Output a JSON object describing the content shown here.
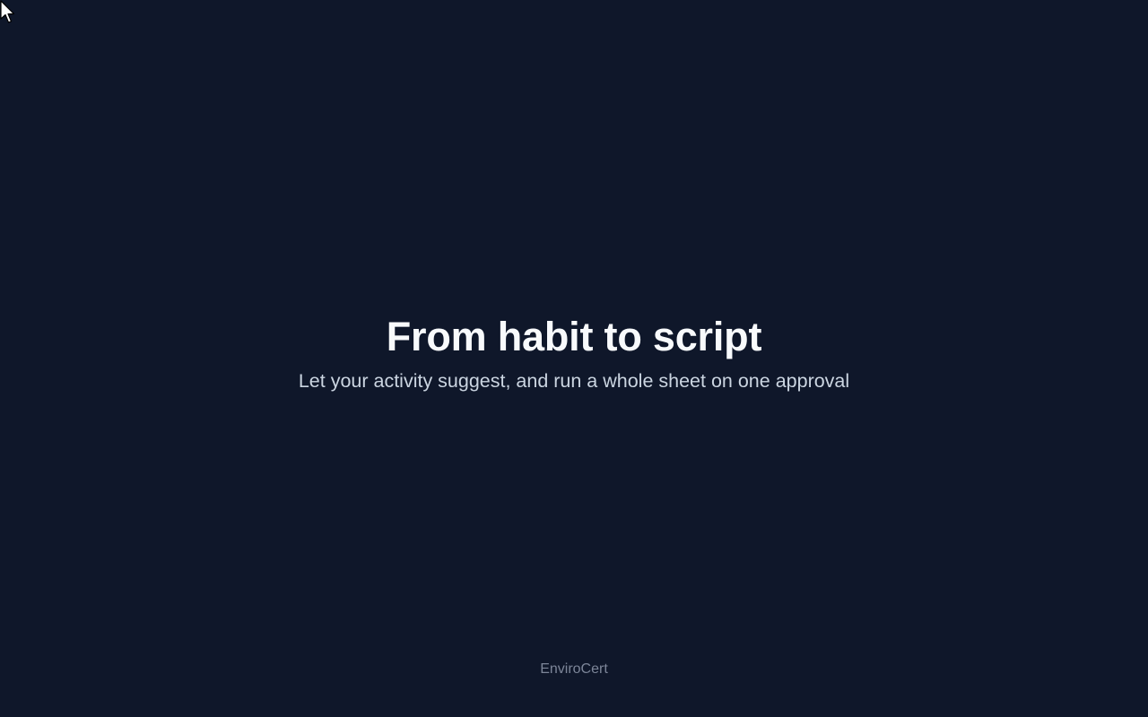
{
  "hero": {
    "title": "From habit to script",
    "subtitle": "Let your activity suggest, and run a whole sheet on one approval"
  },
  "footer": {
    "brand": "EnviroCert"
  },
  "colors": {
    "background": "#0f172a",
    "title": "#f8fafc",
    "subtitle": "#cbd5e1",
    "footer": "#7c8598"
  },
  "cursor": {
    "icon": "arrow-pointer-icon"
  }
}
